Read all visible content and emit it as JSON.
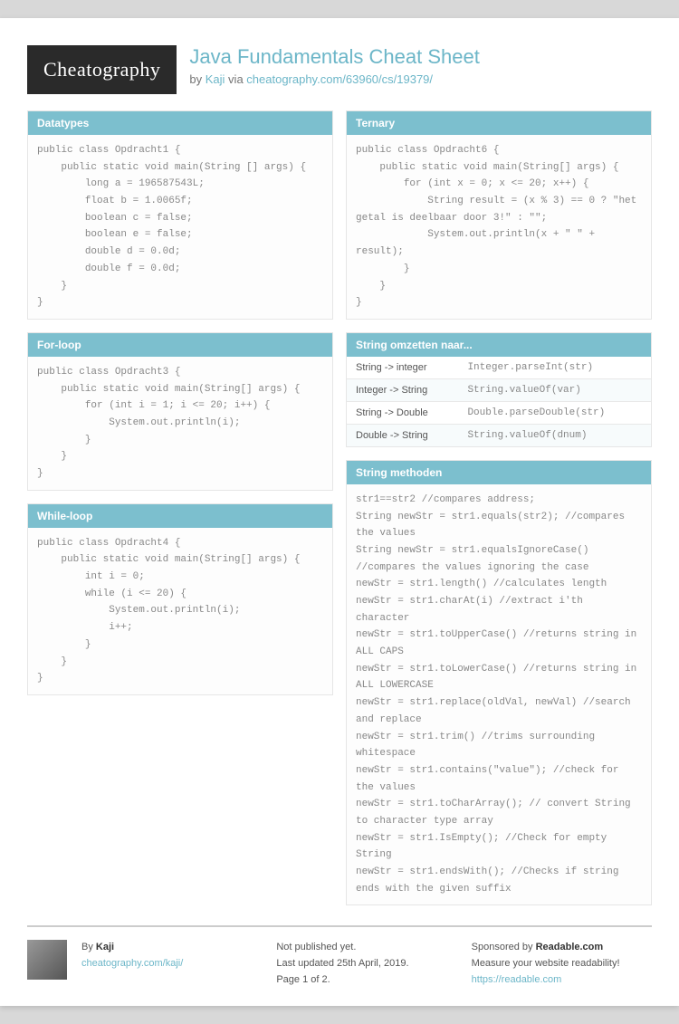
{
  "logo": "Cheatography",
  "title": "Java Fundamentals Cheat Sheet",
  "byline_prefix": "by ",
  "author": "Kaji",
  "via_text": " via ",
  "via_link": "cheatography.com/63960/cs/19379/",
  "blocks": {
    "datatypes": {
      "title": "Datatypes",
      "code": "public class Opdracht1 {\n    public static void main(String [] args) {\n        long a = 196587543L;\n        float b = 1.0065f;\n        boolean c = false;\n        boolean e = false;\n        double d = 0.0d;\n        double f = 0.0d;\n    }\n}"
    },
    "forloop": {
      "title": "For-loop",
      "code": "public class Opdracht3 {\n    public static void main(String[] args) {\n        for (int i = 1; i <= 20; i++) {\n            System.out.println(i);\n        }\n    }\n}"
    },
    "whileloop": {
      "title": "While-loop",
      "code": "public class Opdracht4 {\n    public static void main(String[] args) {\n        int i = 0;\n        while (i <= 20) {\n            System.out.println(i);\n            i++;\n        }\n    }\n}"
    },
    "ternary": {
      "title": "Ternary",
      "code": "public class Opdracht6 {\n    public static void main(String[] args) {\n        for (int x = 0; x <= 20; x++) {\n            String result = (x % 3) == 0 ? \"het getal is deelbaar door 3!\" : \"\";\n            System.out.println(x + \" \" + result);\n        }\n    }\n}"
    },
    "omzetten": {
      "title": "String omzetten naar...",
      "rows": [
        {
          "l": "String -> integer",
          "r": "Integer.parseInt(str)"
        },
        {
          "l": "Integer -> String",
          "r": "String.valueOf(var)"
        },
        {
          "l": "String -> Double",
          "r": "Double.parseDouble(str)"
        },
        {
          "l": "Double -> String",
          "r": "String.valueOf(dnum)"
        }
      ]
    },
    "methoden": {
      "title": "String methoden",
      "code": "str1==str2 //compares address;\nString newStr = str1.equals(str2); //compares the values\nString newStr = str1.equalsIgnoreCase() //compares the values ignoring the case\nnewStr = str1.length() //calculates length\nnewStr = str1.charAt(i) //extract i'th character\nnewStr = str1.toUpperCase() //returns string in ALL CAPS\nnewStr = str1.toLowerCase() //returns string in ALL LOWERCASE\nnewStr = str1.replace(oldVal, newVal) //search and replace\nnewStr = str1.trim() //trims surrounding whitespace\nnewStr = str1.contains(\"value\"); //check for the values\nnewStr = str1.toCharArray(); // convert String to character type array\nnewStr = str1.IsEmpty(); //Check for empty String\nnewStr = str1.endsWith(); //Checks if string ends with the given suffix"
    }
  },
  "footer": {
    "by_label": "By ",
    "author": "Kaji",
    "author_link": "cheatography.com/kaji/",
    "pub1": "Not published yet.",
    "pub2": "Last updated 25th April, 2019.",
    "pub3": "Page 1 of 2.",
    "spon_label": "Sponsored by ",
    "spon_name": "Readable.com",
    "spon_tag": "Measure your website readability!",
    "spon_link": "https://readable.com"
  }
}
